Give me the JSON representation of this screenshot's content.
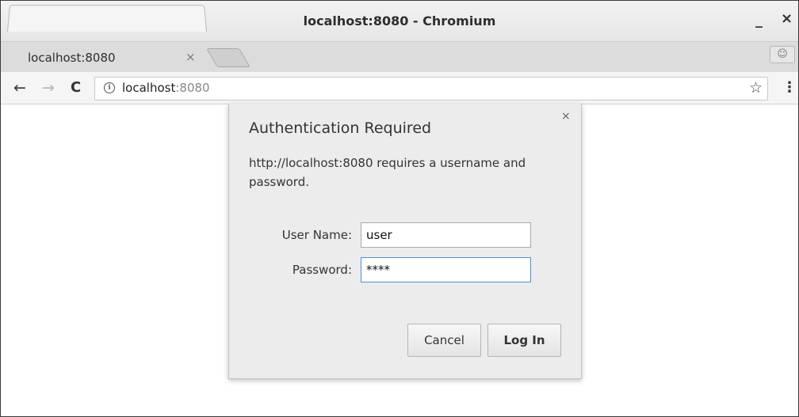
{
  "window": {
    "title": "localhost:8080 - Chromium",
    "minimize_glyph": "_",
    "close_glyph": "×"
  },
  "tabs": [
    {
      "label": "localhost:8080",
      "close_glyph": "×"
    }
  ],
  "toolbar": {
    "back_glyph": "←",
    "forward_glyph": "→",
    "reload_glyph": "C",
    "info_glyph": "i",
    "url_host": "localhost",
    "url_port": ":8080",
    "star_glyph": "☆",
    "menu_glyph": "⋮",
    "profile_glyph": "☺"
  },
  "dialog": {
    "title": "Authentication Required",
    "message": "http://localhost:8080 requires a username and password.",
    "close_glyph": "×",
    "username_label": "User Name:",
    "username_value": "user",
    "password_label": "Password:",
    "password_value": "****",
    "cancel_label": "Cancel",
    "login_label": "Log In"
  },
  "icons": {
    "back": "back-arrow-icon",
    "forward": "forward-arrow-icon",
    "reload": "reload-icon",
    "info": "info-icon",
    "star": "bookmark-star-icon",
    "menu": "kebab-menu-icon",
    "profile": "profile-icon"
  },
  "colors": {
    "focus_border": "#4a90d9",
    "dialog_bg": "#ececec",
    "toolbar_bg": "#f5f5f5"
  }
}
